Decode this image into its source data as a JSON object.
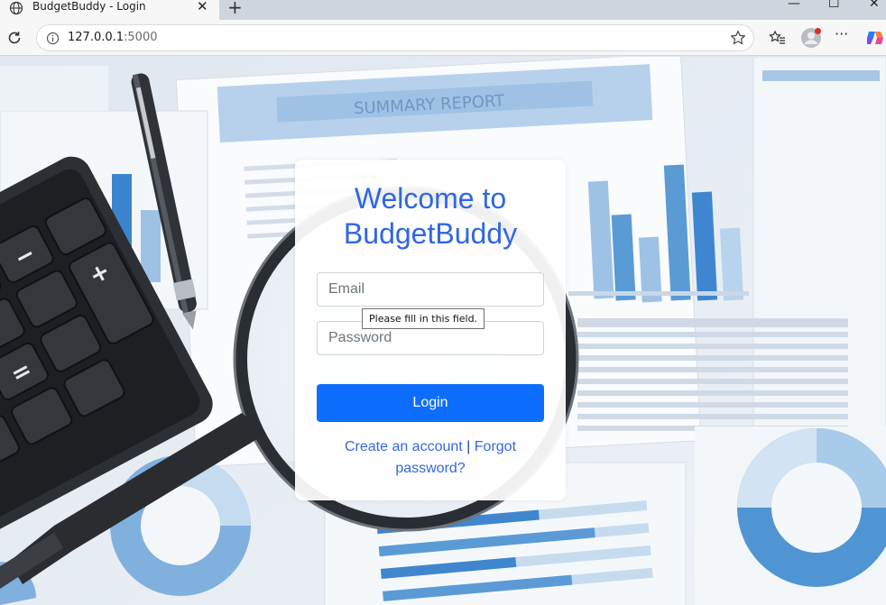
{
  "browser": {
    "tab_title": "BudgetBuddy - Login",
    "url_host": "127.0.0.1",
    "url_port": ":5000"
  },
  "login": {
    "heading_line1": "Welcome to",
    "heading_line2": "BudgetBuddy",
    "email_placeholder": "Email",
    "password_placeholder": "Password",
    "validation_tooltip": "Please fill in this field.",
    "login_label": "Login",
    "create_account_label": "Create an account",
    "separator": "|",
    "forgot_label_1": "Forgot",
    "forgot_label_2": "password?",
    "accent_color": "#2f66e6",
    "button_color": "#0d6efd"
  },
  "background": {
    "report_title": "SUMMARY REPORT"
  }
}
